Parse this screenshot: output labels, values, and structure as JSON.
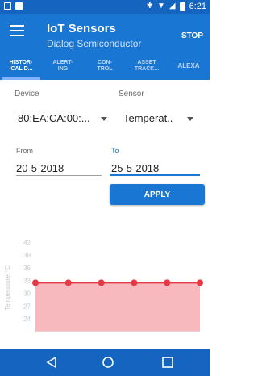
{
  "status_bar": {
    "time": "6:21"
  },
  "header": {
    "title": "IoT Sensors",
    "subtitle": "Dialog Semiconductor",
    "stop_label": "STOP"
  },
  "tabs": [
    {
      "line1": "HISTOR-",
      "line2": "ICAL D...",
      "active": true
    },
    {
      "line1": "ALERT-",
      "line2": "ING"
    },
    {
      "line1": "CON-",
      "line2": "TROL"
    },
    {
      "line1": "ASSET",
      "line2": "TRACK..."
    },
    {
      "line1": "ALEXA",
      "line2": ""
    }
  ],
  "filters": {
    "device_label": "Device",
    "device_value": "80:EA:CA:00:...",
    "sensor_label": "Sensor",
    "sensor_value": "Temperat..",
    "from_label": "From",
    "from_value": "20-5-2018",
    "to_label": "To",
    "to_value": "25-5-2018",
    "apply_label": "APPLY"
  },
  "chart_data": {
    "type": "area",
    "ylabel": "Temperature °C",
    "y_ticks": [
      42,
      39,
      36,
      33,
      30,
      27,
      24
    ],
    "ylim": [
      21,
      43
    ],
    "x": [
      0,
      1,
      2,
      3,
      4,
      5
    ],
    "series": [
      {
        "values": [
          32.5,
          32.5,
          32.5,
          32.5,
          32.5,
          32.5
        ]
      }
    ],
    "line_color": "#e53945",
    "fill_color": "#f7b9bd",
    "grid": false
  },
  "nav": {
    "back_icon": "back-triangle-icon",
    "home_icon": "home-circle-icon",
    "recents_icon": "recents-square-icon"
  }
}
